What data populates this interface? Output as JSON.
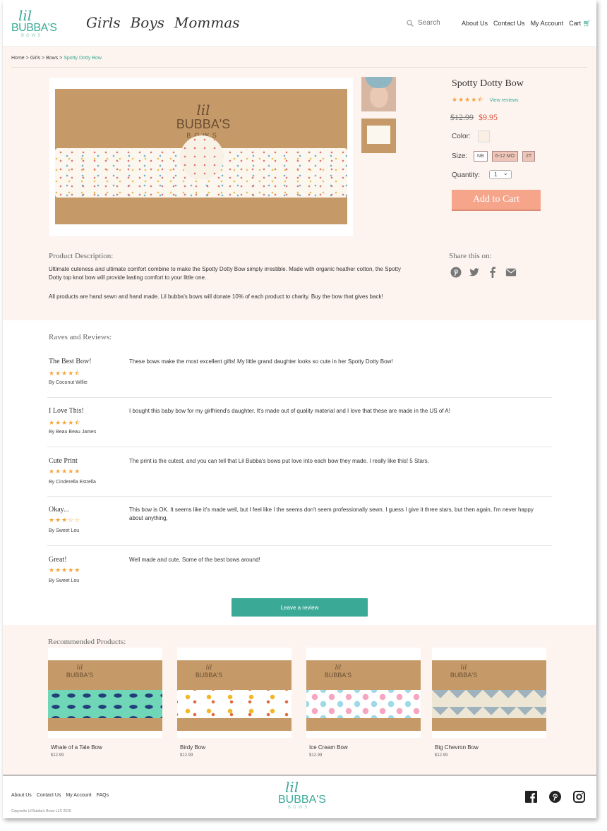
{
  "brand": {
    "logo_lil": "lil",
    "logo_name": "BUBBA'S",
    "logo_sub": "BOWS"
  },
  "nav": {
    "items": [
      "Girls",
      "Boys",
      "Mommas"
    ]
  },
  "search": {
    "placeholder": "Search"
  },
  "top_links": {
    "about": "About Us",
    "contact": "Contact Us",
    "account": "My Account",
    "cart": "Cart"
  },
  "breadcrumb": {
    "home": "Home",
    "girls": "Girls",
    "bows": "Bows",
    "current": "Spotty Dotty Bow",
    "sep": ">"
  },
  "product": {
    "title": "Spotty Dotty Bow",
    "rating_stars": "★★★★⯪",
    "view_reviews": "View reviews",
    "old_price": "$12.99",
    "new_price": "$9.95",
    "color_label": "Color:",
    "size_label": "Size:",
    "sizes": [
      "NB",
      "6-12 MO",
      "2T"
    ],
    "quantity_label": "Quantity:",
    "quantity_value": "1",
    "add_to_cart": "Add to Cart",
    "stamp_lil": "lil",
    "stamp_name": "BUBBA'S",
    "stamp_sub": "BOWS"
  },
  "description": {
    "heading": "Product Description:",
    "p1": "Ultimate cuteness and ultimate comfort combine to make the Spotty Dotty Bow simply irrestible.  Made with organic heather cotton, the Spotty Dotty top knot bow will provide lasting comfort to your little one.",
    "p2": "All products are hand sewn and hand made. Lil bubba's bows will donate 10% of each product to charity. Buy the bow that gives back!"
  },
  "share": {
    "heading": "Share this on:"
  },
  "reviews": {
    "heading": "Raves and Reviews:",
    "items": [
      {
        "title": "The Best Bow!",
        "stars": "★★★★⯪",
        "by": "By Coconut Willie",
        "text": "These bows make the most excellent gifts! My little grand daughter looks so cute in her Spotty Dotty Bow!"
      },
      {
        "title": "I Love This!",
        "stars": "★★★★⯪",
        "by": "By Beau Beau James",
        "text": "I bought this baby bow for my girlfriend's daughter. It's made out of quality material and I love that these are made in the US of A!"
      },
      {
        "title": "Cute Print",
        "stars": "★★★★★",
        "by": "By Cinderella Estrella",
        "text": "The print is the cutest, and you can tell that Lil Bubba's bows put love into each bow they made. I really like this! 5 Stars."
      },
      {
        "title": "Okay...",
        "stars": "★★★☆☆",
        "by": "By Sweet Lou",
        "text": "This bow is OK. It seems like it's made well, but I feel like I the seems don't seem professionally sewn. I guess I give it three stars, but then again, I'm never happy about anything,"
      },
      {
        "title": "Great!",
        "stars": "★★★★★",
        "by": "By Sweet Lou",
        "text": "Well made and cute. Some of the best bows around!"
      }
    ],
    "leave_button": "Leave a review"
  },
  "recommended": {
    "heading": "Recommended Products:",
    "items": [
      {
        "name": "Whale of a Tale Bow",
        "price": "$12.99"
      },
      {
        "name": "Birdy Bow",
        "price": "$12.99"
      },
      {
        "name": "Ice Cream Bow",
        "price": "$12.99"
      },
      {
        "name": "Big Chevron Bow",
        "price": "$12.99"
      }
    ]
  },
  "footer": {
    "about": "About Us",
    "contact": "Contact Us",
    "account": "My Account",
    "faqs": "FAQs",
    "copyright": "Copywrite Lil Bubba's Bows LLC 2016"
  },
  "colors": {
    "accent": "#3aa996",
    "button": "#f6a58b",
    "sale": "#d8523c",
    "star": "#f2a33a",
    "panel": "#fdf4ef"
  },
  "icons": [
    "search-icon",
    "cart-icon",
    "pinterest-icon",
    "twitter-icon",
    "facebook-icon",
    "envelope-icon",
    "instagram-icon"
  ]
}
